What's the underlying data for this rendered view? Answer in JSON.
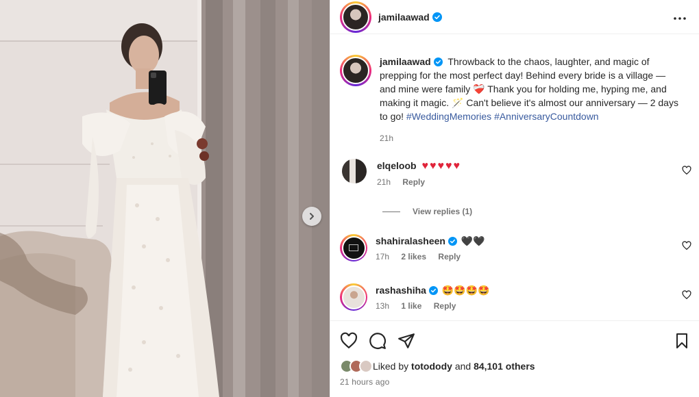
{
  "post": {
    "author": "jamilaawad",
    "caption_part1": "Throwback to the chaos, laughter, and magic of prepping for the most perfect day! Behind every bride is a village — and mine were family",
    "caption_emoji1": "❤️‍🩹",
    "caption_part2": "Thank you for holding me, hyping me, and making it magic.",
    "caption_emoji2": "🪄",
    "caption_part3": "Can't believe it's almost our anniversary — 2 days to go!",
    "hashtags": [
      "#WeddingMemories",
      "#AnniversaryCountdown"
    ],
    "caption_time": "21h"
  },
  "comments": [
    {
      "user": "elqeloob",
      "text": "♥♥♥♥♥",
      "time": "21h",
      "likes": "",
      "reply": "Reply",
      "verified": false
    },
    {
      "user": "shahiralasheen",
      "text": "🖤🖤",
      "time": "17h",
      "likes": "2 likes",
      "reply": "Reply",
      "verified": true
    },
    {
      "user": "rashashiha",
      "text": "🤩🤩🤩🤩",
      "time": "13h",
      "likes": "1 like",
      "reply": "Reply",
      "verified": true
    }
  ],
  "view_replies": "View replies (1)",
  "likes": {
    "prefix": "Liked by",
    "user": "totodody",
    "and": "and",
    "others": "84,101 others"
  },
  "time_ago": "21 hours ago",
  "icons": {
    "more": "more-horizontal-icon",
    "like": "heart-icon",
    "comment": "comment-icon",
    "share": "share-icon",
    "save": "bookmark-icon",
    "next": "chevron-right-icon",
    "verified": "verified-badge-icon"
  },
  "colors": {
    "verified": "#0095f6",
    "hashtag": "#385a9e",
    "muted": "#737373"
  }
}
